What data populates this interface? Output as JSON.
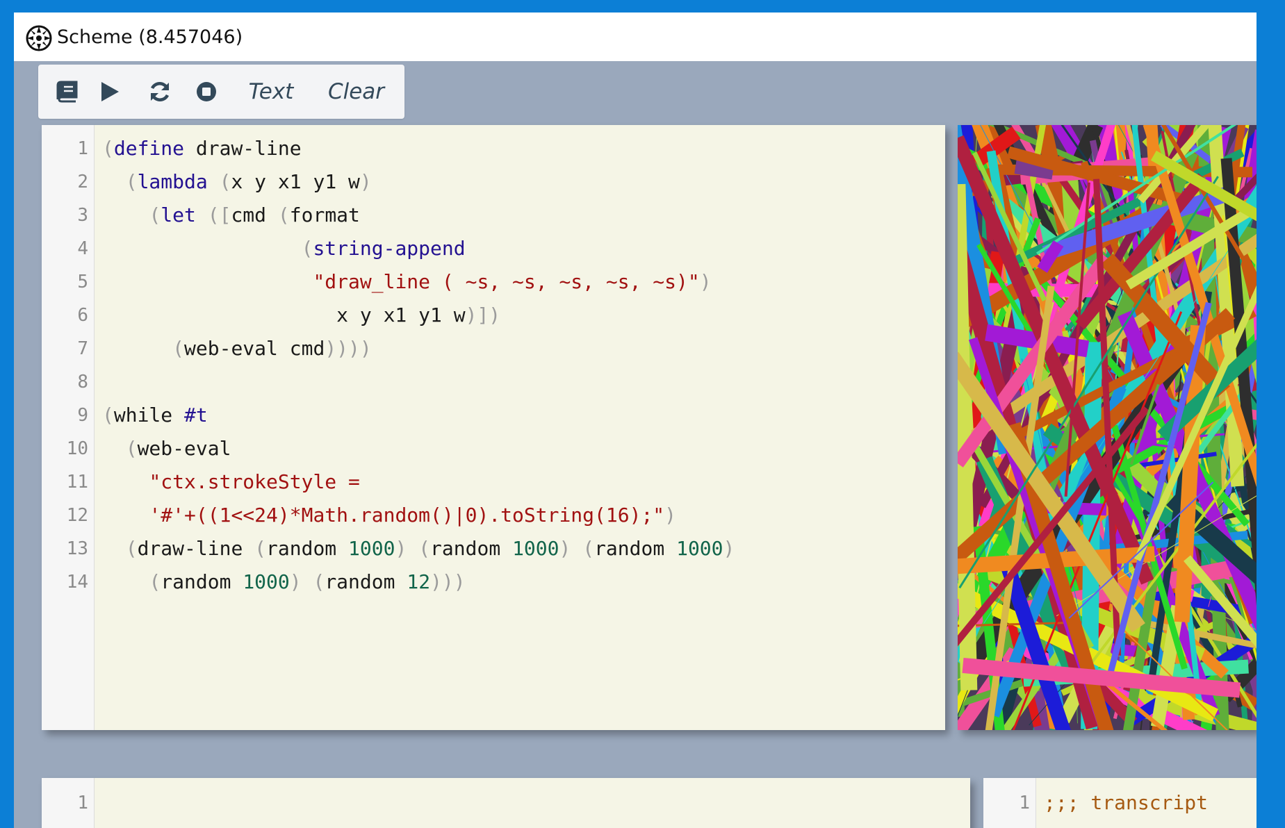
{
  "window": {
    "title": "Scheme (8.457046)"
  },
  "toolbar": {
    "buttons": [
      {
        "name": "book-button",
        "icon": "book-icon"
      },
      {
        "name": "run-button",
        "icon": "play-icon"
      },
      {
        "name": "reload-button",
        "icon": "refresh-icon"
      },
      {
        "name": "stop-button",
        "icon": "stop-icon"
      }
    ],
    "text_label": "Text",
    "clear_label": "Clear"
  },
  "editor": {
    "line_numbers": [
      "1",
      "2",
      "3",
      "4",
      "5",
      "6",
      "7",
      "8",
      "9",
      "10",
      "11",
      "12",
      "13",
      "14"
    ],
    "lines": [
      [
        {
          "t": "(",
          "c": "par"
        },
        {
          "t": "define",
          "c": "kw"
        },
        {
          "t": " draw-line",
          "c": ""
        }
      ],
      [
        {
          "t": "  ",
          "c": ""
        },
        {
          "t": "(",
          "c": "par"
        },
        {
          "t": "lambda",
          "c": "kw"
        },
        {
          "t": " ",
          "c": ""
        },
        {
          "t": "(",
          "c": "par"
        },
        {
          "t": "x y x1 y1 w",
          "c": ""
        },
        {
          "t": ")",
          "c": "par"
        }
      ],
      [
        {
          "t": "    ",
          "c": ""
        },
        {
          "t": "(",
          "c": "par"
        },
        {
          "t": "let",
          "c": "kw"
        },
        {
          "t": " ",
          "c": ""
        },
        {
          "t": "([",
          "c": "par"
        },
        {
          "t": "cmd ",
          "c": ""
        },
        {
          "t": "(",
          "c": "par"
        },
        {
          "t": "format",
          "c": ""
        }
      ],
      [
        {
          "t": "                 ",
          "c": ""
        },
        {
          "t": "(",
          "c": "par"
        },
        {
          "t": "string-append",
          "c": "kw"
        }
      ],
      [
        {
          "t": "                  ",
          "c": ""
        },
        {
          "t": "\"draw_line ( ~s, ~s, ~s, ~s, ~s)\"",
          "c": "str"
        },
        {
          "t": ")",
          "c": "par"
        }
      ],
      [
        {
          "t": "                    x y x1 y1 w",
          "c": ""
        },
        {
          "t": ")])",
          "c": "par"
        }
      ],
      [
        {
          "t": "      ",
          "c": ""
        },
        {
          "t": "(",
          "c": "par"
        },
        {
          "t": "web-eval cmd",
          "c": ""
        },
        {
          "t": "))))",
          "c": "par"
        }
      ],
      [],
      [
        {
          "t": "(",
          "c": "par"
        },
        {
          "t": "while ",
          "c": ""
        },
        {
          "t": "#t",
          "c": "kw"
        }
      ],
      [
        {
          "t": "  ",
          "c": ""
        },
        {
          "t": "(",
          "c": "par"
        },
        {
          "t": "web-eval",
          "c": ""
        }
      ],
      [
        {
          "t": "    ",
          "c": ""
        },
        {
          "t": "\"ctx.strokeStyle =",
          "c": "str"
        }
      ],
      [
        {
          "t": "    ",
          "c": ""
        },
        {
          "t": "'#'+((1<<24)*Math.random()|0).toString(16);\"",
          "c": "str"
        },
        {
          "t": ")",
          "c": "par"
        }
      ],
      [
        {
          "t": "  ",
          "c": ""
        },
        {
          "t": "(",
          "c": "par"
        },
        {
          "t": "draw-line ",
          "c": ""
        },
        {
          "t": "(",
          "c": "par"
        },
        {
          "t": "random ",
          "c": ""
        },
        {
          "t": "1000",
          "c": "num"
        },
        {
          "t": ")",
          "c": "par"
        },
        {
          "t": " ",
          "c": ""
        },
        {
          "t": "(",
          "c": "par"
        },
        {
          "t": "random ",
          "c": ""
        },
        {
          "t": "1000",
          "c": "num"
        },
        {
          "t": ")",
          "c": "par"
        },
        {
          "t": " ",
          "c": ""
        },
        {
          "t": "(",
          "c": "par"
        },
        {
          "t": "random ",
          "c": ""
        },
        {
          "t": "1000",
          "c": "num"
        },
        {
          "t": ")",
          "c": "par"
        }
      ],
      [
        {
          "t": "    ",
          "c": ""
        },
        {
          "t": "(",
          "c": "par"
        },
        {
          "t": "random ",
          "c": ""
        },
        {
          "t": "1000",
          "c": "num"
        },
        {
          "t": ")",
          "c": "par"
        },
        {
          "t": " ",
          "c": ""
        },
        {
          "t": "(",
          "c": "par"
        },
        {
          "t": "random ",
          "c": ""
        },
        {
          "t": "12",
          "c": "num"
        },
        {
          "t": ")))",
          "c": "par"
        }
      ]
    ]
  },
  "repl": {
    "line_numbers": [
      "1"
    ],
    "content": ""
  },
  "transcript": {
    "line_numbers": [
      "1"
    ],
    "content": ";;; transcript"
  },
  "colors": {
    "keyword": "#231191",
    "string": "#a11111",
    "number": "#11644a",
    "paren": "#9b9b9b",
    "comment": "#a65a12",
    "editor_bg": "#f5f5e6",
    "window_bg": "#9aa8bc"
  }
}
